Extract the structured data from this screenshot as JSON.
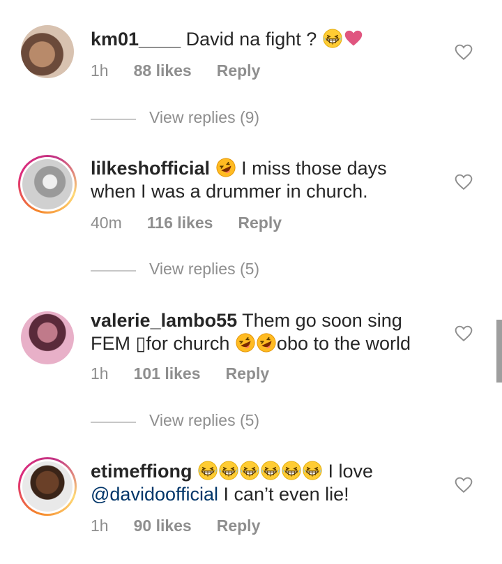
{
  "comments": [
    {
      "username": "km01____",
      "body": "David na fight ?",
      "time": "1h",
      "likes": "88 likes",
      "reply": "Reply",
      "view_replies": "View replies (9)"
    },
    {
      "username": "lilkeshofficial",
      "body_line1": "I miss those days",
      "body_line2": "when I was a drummer in church.",
      "time": "40m",
      "likes": "116 likes",
      "reply": "Reply",
      "view_replies": "View replies (5)"
    },
    {
      "username": "valerie_lambo55",
      "body_line1": "Them go soon sing",
      "body_line2a": "FEM ▯for church",
      "body_line2b": "obo to the world",
      "time": "1h",
      "likes": "101 likes",
      "reply": "Reply",
      "view_replies": "View replies (5)"
    },
    {
      "username": "etimeffiong",
      "body_line1": "I love",
      "mention": "@davidoofficial",
      "body_line2": " I can’t even lie!",
      "time": "1h",
      "likes": "90 likes",
      "reply": "Reply"
    }
  ],
  "colors": {
    "story_ring_start": "#f58529",
    "story_ring_end": "#c13584",
    "mention": "#003569",
    "meta_gray": "#8e8e8e",
    "heart_emoji": "#e0557f",
    "emoji_yellow": "#ffcc33"
  },
  "icons": [
    "heart-outline-icon",
    "grinning-squinting-face-emoji",
    "rolling-laughing-face-emoji",
    "red-heart-emoji"
  ]
}
